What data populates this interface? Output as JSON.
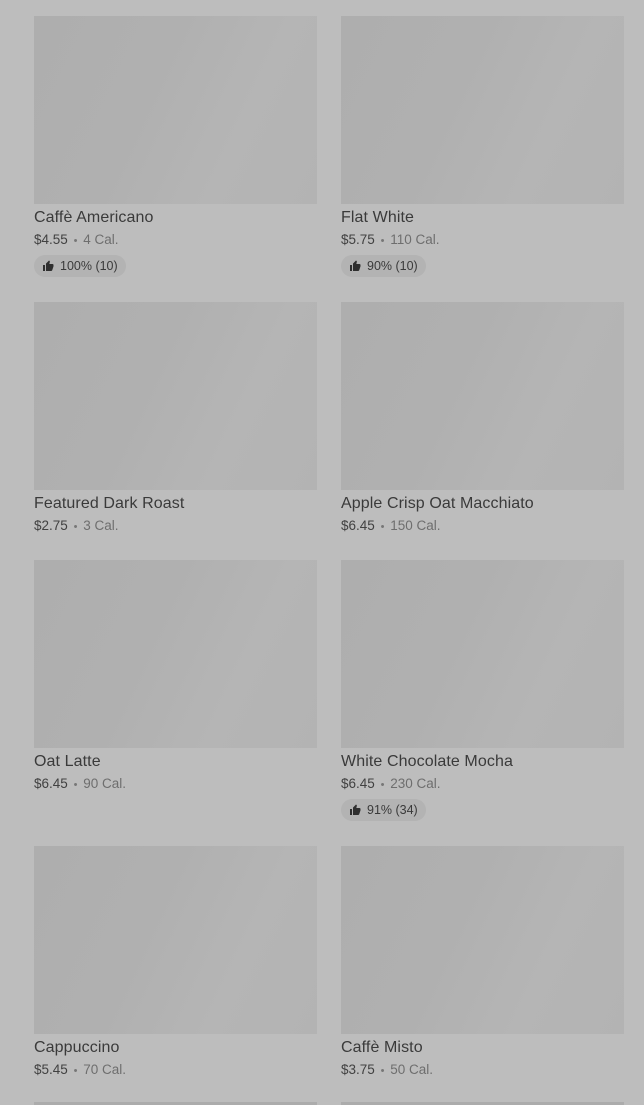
{
  "items": [
    {
      "name": "Caffè Americano",
      "price": "$4.55",
      "calories": "4 Cal.",
      "rating": "100% (10)"
    },
    {
      "name": "Flat White",
      "price": "$5.75",
      "calories": "110 Cal.",
      "rating": "90% (10)"
    },
    {
      "name": "Featured Dark Roast",
      "price": "$2.75",
      "calories": "3 Cal."
    },
    {
      "name": "Apple Crisp Oat Macchiato",
      "price": "$6.45",
      "calories": "150 Cal."
    },
    {
      "name": "Oat Latte",
      "price": "$6.45",
      "calories": "90 Cal."
    },
    {
      "name": "White Chocolate Mocha",
      "price": "$6.45",
      "calories": "230 Cal.",
      "rating": "91% (34)"
    },
    {
      "name": "Cappuccino",
      "price": "$5.45",
      "calories": "70 Cal."
    },
    {
      "name": "Caffè Misto",
      "price": "$3.75",
      "calories": "50 Cal."
    }
  ],
  "separator": "•",
  "icons": {
    "rating": "thumbs-up-icon"
  }
}
